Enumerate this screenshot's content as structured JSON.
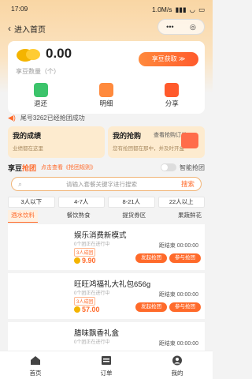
{
  "status": {
    "time": "17:09",
    "net": "1.0M/s",
    "signal": "▮▮▮",
    "wifi": "◡",
    "battery": "▭"
  },
  "nav": {
    "back": "‹",
    "title": "进入首页",
    "capsule_menu": "•••",
    "capsule_close": "◎"
  },
  "wallet": {
    "amount": "0.00",
    "label": "享豆数量（个）",
    "get_btn": "享豆获取 ≫",
    "actions": [
      {
        "label": "退还",
        "icon": "return-icon"
      },
      {
        "label": "明细",
        "icon": "detail-icon"
      },
      {
        "label": "分享",
        "icon": "share-icon"
      }
    ]
  },
  "notice": {
    "text": "尾号3262已经抢团成功"
  },
  "cards": [
    {
      "title": "我的成绩",
      "sub": "业绩都在这里"
    },
    {
      "title": "我的抢购",
      "link": "查看抢购订单 ›",
      "sub": "您有抢团都在那中，并及时开盒"
    }
  ],
  "lot": {
    "title1": "享豆",
    "title2": "抢团",
    "tip": "点击查看《抢团规则》",
    "switch": "智能抢团"
  },
  "search": {
    "placeholder": "请输入套餐关键字进行搜索",
    "button": "搜索"
  },
  "filters": [
    "3人以下",
    "4-7人",
    "8-21人",
    "22人以上"
  ],
  "categories": [
    "酒水饮料",
    "餐饮熟食",
    "提货券区",
    "果蔬鲜花"
  ],
  "items": [
    {
      "name": "娱乐消费新模式",
      "sub": "0个团正在进行中",
      "tag": "3人成团",
      "price": "9.90",
      "countdown": "距结束 00:00:00",
      "btn_a": "发起抢团",
      "btn_b": "参与抢团"
    },
    {
      "name": "旺旺鸿福礼大礼包656g",
      "sub": "0个团正在进行中",
      "tag": "3人成团",
      "price": "57.00",
      "countdown": "距结束 00:00:00",
      "btn_a": "发起抢团",
      "btn_b": "参与抢团"
    },
    {
      "name": "腊味飘香礼盒",
      "sub": "0个团正在进行中",
      "tag": "3人成团",
      "price": "",
      "countdown": "距结束 00:00:00",
      "btn_a": "",
      "btn_b": ""
    }
  ],
  "tabs": [
    {
      "label": "首页",
      "icon": "home-icon"
    },
    {
      "label": "订单",
      "icon": "order-icon"
    },
    {
      "label": "我的",
      "icon": "user-icon"
    }
  ],
  "colors": {
    "accent": "#ff6a2a",
    "header": "#f9d6a4"
  }
}
